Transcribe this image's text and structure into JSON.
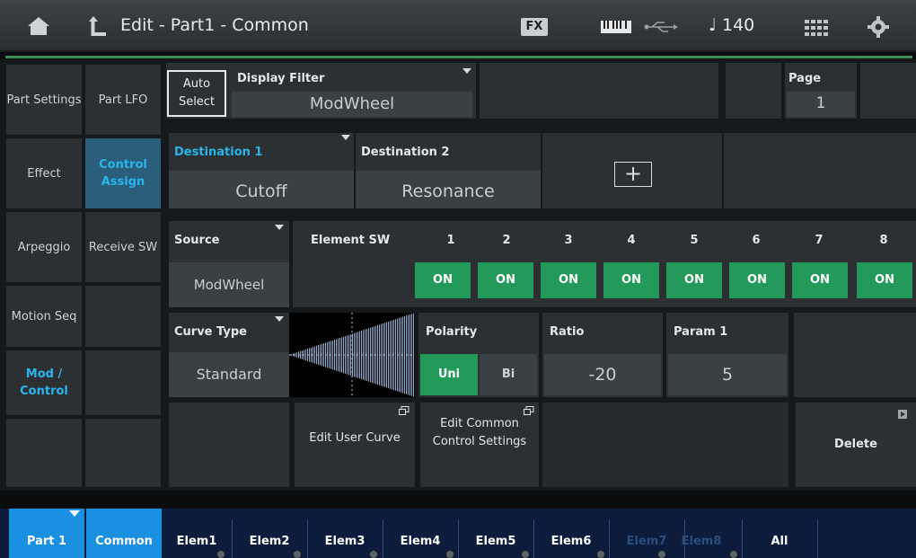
{
  "header": {
    "title": "Edit - Part1 - Common",
    "fx_badge": "FX",
    "tempo": "♩ 140"
  },
  "sidebar": {
    "col1": [
      {
        "label": "Part Settings"
      },
      {
        "label": "Effect"
      },
      {
        "label": "Arpeggio"
      },
      {
        "label": "Motion Seq"
      },
      {
        "label": "Mod / Control"
      }
    ],
    "col2": [
      {
        "label": "Part LFO"
      },
      {
        "label": "Control Assign"
      },
      {
        "label": "Receive SW"
      }
    ]
  },
  "filter_row": {
    "auto_select": "Auto Select",
    "display_filter_label": "Display Filter",
    "display_filter_value": "ModWheel",
    "page_label": "Page",
    "page_value": "1"
  },
  "destinations": {
    "dest1_label": "Destination 1",
    "dest1_value": "Cutoff",
    "dest2_label": "Destination 2",
    "dest2_value": "Resonance",
    "add_symbol": "+"
  },
  "source": {
    "label": "Source",
    "value": "ModWheel",
    "element_sw_label": "Element SW",
    "elements": [
      {
        "num": "1",
        "state": "ON"
      },
      {
        "num": "2",
        "state": "ON"
      },
      {
        "num": "3",
        "state": "ON"
      },
      {
        "num": "4",
        "state": "ON"
      },
      {
        "num": "5",
        "state": "ON"
      },
      {
        "num": "6",
        "state": "ON"
      },
      {
        "num": "7",
        "state": "ON"
      },
      {
        "num": "8",
        "state": "ON"
      }
    ]
  },
  "curve": {
    "curve_type_label": "Curve Type",
    "curve_type_value": "Standard",
    "polarity_label": "Polarity",
    "polarity_uni": "Uni",
    "polarity_bi": "Bi",
    "polarity_selected": "Uni",
    "ratio_label": "Ratio",
    "ratio_value": "-20",
    "param1_label": "Param 1",
    "param1_value": "5"
  },
  "actions": {
    "edit_user_curve": "Edit User Curve",
    "edit_common_control": "Edit Common Control Settings",
    "delete": "Delete"
  },
  "bottom_tabs": {
    "part": "Part 1",
    "common": "Common",
    "elems": [
      {
        "label": "Elem1",
        "enabled": true
      },
      {
        "label": "Elem2",
        "enabled": true
      },
      {
        "label": "Elem3",
        "enabled": true
      },
      {
        "label": "Elem4",
        "enabled": true
      },
      {
        "label": "Elem5",
        "enabled": true
      },
      {
        "label": "Elem6",
        "enabled": true
      },
      {
        "label": "Elem7",
        "enabled": false
      },
      {
        "label": "Elem8",
        "enabled": false
      }
    ],
    "all": "All"
  },
  "colors": {
    "accent_blue": "#29b6ec",
    "on_green": "#23995a",
    "tab_blue": "#1a90e0"
  }
}
